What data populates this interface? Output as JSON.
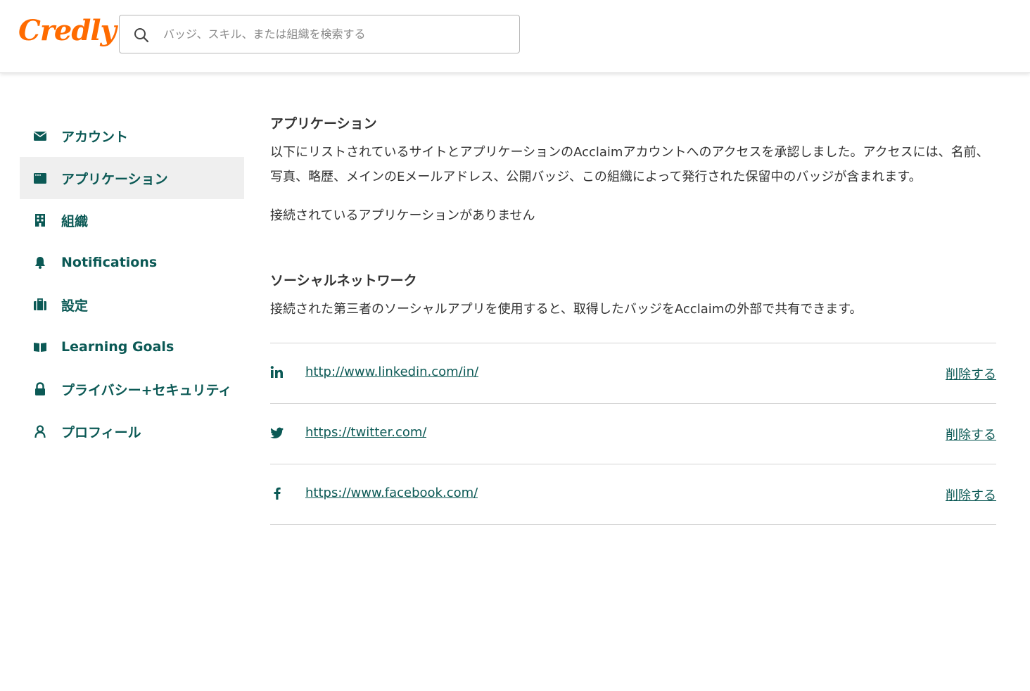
{
  "header": {
    "logo": "Credly",
    "search_placeholder": "バッジ、スキル、または組織を検索する"
  },
  "sidebar": {
    "items": [
      {
        "label": "アカウント",
        "icon": "envelope-icon"
      },
      {
        "label": "アプリケーション",
        "icon": "window-icon",
        "active": true
      },
      {
        "label": "組織",
        "icon": "building-icon"
      },
      {
        "label": "Notifications",
        "icon": "bell-icon"
      },
      {
        "label": "設定",
        "icon": "briefcase-icon"
      },
      {
        "label": "Learning Goals",
        "icon": "book-icon"
      },
      {
        "label": "プライバシー+セキュリティ",
        "icon": "lock-icon"
      },
      {
        "label": "プロフィール",
        "icon": "user-icon"
      }
    ]
  },
  "main": {
    "applications": {
      "title": "アプリケーション",
      "description": "以下にリストされているサイトとアプリケーションのAcclaimアカウントへのアクセスを承認しました。アクセスには、名前、写真、略歴、メインのEメールアドレス、公開バッジ、この組織によって発行された保留中のバッジが含まれます。",
      "empty_message": "接続されているアプリケーションがありません"
    },
    "social": {
      "title": "ソーシャルネットワーク",
      "description": "接続された第三者のソーシャルアプリを使用すると、取得したバッジをAcclaimの外部で共有できます。",
      "networks": [
        {
          "icon": "linkedin-icon",
          "url": "http://www.linkedin.com/in/",
          "action": "削除する"
        },
        {
          "icon": "twitter-icon",
          "url": "https://twitter.com/",
          "action": "削除する"
        },
        {
          "icon": "facebook-icon",
          "url": "https://www.facebook.com/",
          "action": "削除する"
        }
      ]
    }
  },
  "colors": {
    "brand_orange": "#ff6b00",
    "accent_teal": "#0b5955",
    "text": "#333333",
    "active_bg": "#efefef",
    "divider": "#d4d4d4"
  }
}
